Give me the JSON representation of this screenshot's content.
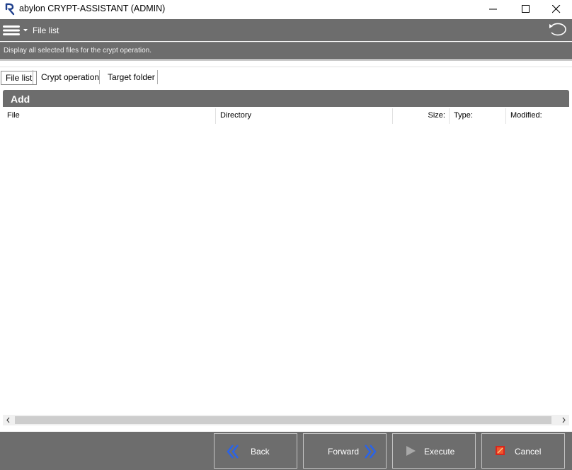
{
  "window": {
    "title": "abylon CRYPT-ASSISTANT (ADMIN)"
  },
  "toolbar": {
    "title": "File list",
    "icons": [
      "menu-icon",
      "refresh-icon"
    ]
  },
  "description": "Display all selected files for the crypt operation.",
  "tabs": [
    {
      "label": "File list",
      "active": true
    },
    {
      "label": "Crypt operation",
      "active": false
    },
    {
      "label": "Target folder",
      "active": false
    }
  ],
  "panel": {
    "add_label": "Add",
    "columns": [
      "File",
      "Directory",
      "Size:",
      "Type:",
      "Modified:"
    ]
  },
  "footer": {
    "back": "Back",
    "forward": "Forward",
    "execute": "Execute",
    "cancel": "Cancel"
  },
  "colors": {
    "toolbar_bg": "#6d6d6d",
    "arrow_blue": "#2a63e8",
    "cancel_red": "#d8261c"
  }
}
